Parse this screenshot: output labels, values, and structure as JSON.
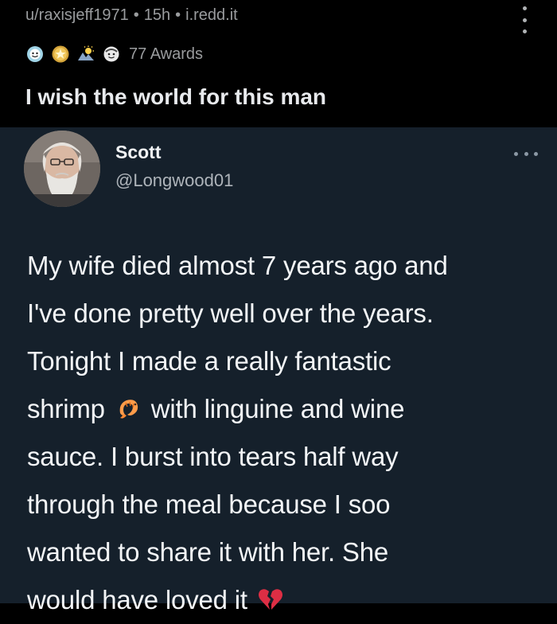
{
  "post": {
    "subreddit_user": "u/raxisjeff1971",
    "separator": "•",
    "age": "15h",
    "domain": "i.redd.it",
    "awards": {
      "icons": [
        "wholesome-award-icon",
        "silver-award-icon",
        "sun-award-icon",
        "helpful-award-icon"
      ],
      "count_label": "77 Awards"
    },
    "title": "I wish the world for this man"
  },
  "tweet": {
    "author_name": "Scott",
    "author_handle": "@Longwood01",
    "lines": [
      {
        "text": "My wife died almost 7 years ago and"
      },
      {
        "text": "I've done pretty well over the years."
      },
      {
        "text": "Tonight I made a really fantastic"
      },
      {
        "before": "shrimp",
        "emoji": "shrimp-emoji",
        "after": " with linguine and wine"
      },
      {
        "text": "sauce. I burst into tears half way"
      },
      {
        "text": "through the meal because I soo"
      },
      {
        "text": "wanted to share it with her. She"
      },
      {
        "before": "would have loved it ",
        "emoji": "broken-heart-emoji",
        "after": ""
      }
    ]
  },
  "colors": {
    "header_bg": "#000000",
    "card_bg": "#15202b",
    "meta_text": "#9a9c9e",
    "title_text": "#e8eaed",
    "tweet_text": "#f3f5f7",
    "handle_text": "#aeb4ba"
  }
}
